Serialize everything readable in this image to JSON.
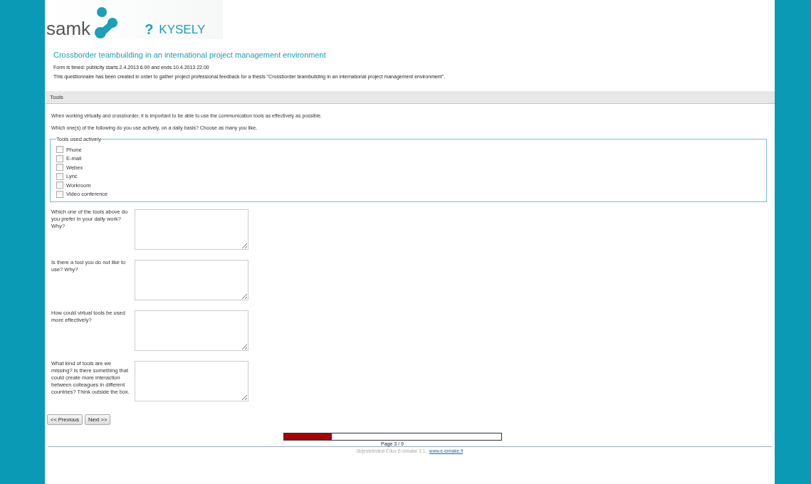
{
  "header": {
    "logo_text": "samk",
    "app_title": "KYSELY",
    "app_icon": "?"
  },
  "form": {
    "title": "Crossborder teambuilding in an international project management environment",
    "timing": "Form is timed: publicity starts 2.4.2013 6.00 and ends 10.4.2013 22.00",
    "description": "This questionnaire has been created in order to gather project professional feedback for a thesis \"Crossborder teambuilding in an international project management environment\"."
  },
  "section": {
    "title": "Tools",
    "intro": [
      "When working virtually and crossborder, it is important to be able to use the communication tools as effectively as possible.",
      "Which one(s) of the following do you use actively, on a daily basis? Choose as many you like,"
    ],
    "fieldset": {
      "legend": "Tools used actively",
      "options": [
        {
          "label": "Phone",
          "checked": false
        },
        {
          "label": "E-mail",
          "checked": false
        },
        {
          "label": "Webex",
          "checked": false
        },
        {
          "label": "Lync",
          "checked": false
        },
        {
          "label": "Workroom",
          "checked": false
        },
        {
          "label": "Video conference",
          "checked": false
        }
      ]
    },
    "questions": [
      {
        "label": "Which one of the tools above do you prefer in your daily work? Why?"
      },
      {
        "label": "Is there a tool you do not like to use? Why?"
      },
      {
        "label": "How could virtual tools be used more effectively?"
      },
      {
        "label": "What kind of tools are we missing? Is there something that could create more interaction between colleagues in different countries? Think outside the box."
      }
    ]
  },
  "buttons": [
    "<< Previous",
    "Next >>"
  ],
  "progress": {
    "level": 0.222,
    "label": "Page 3 / 9"
  },
  "footer": {
    "text": "Järjestelmänä Edux E-lomake 3.1.",
    "link": "www.e-lomake.fi"
  }
}
